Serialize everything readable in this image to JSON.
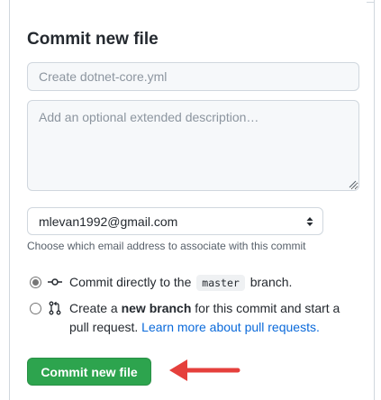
{
  "title": "Commit new file",
  "summary": {
    "placeholder": "Create dotnet-core.yml",
    "value": ""
  },
  "description": {
    "placeholder": "Add an optional extended description…",
    "value": ""
  },
  "email_select": {
    "selected": "mlevan1992@gmail.com"
  },
  "email_note": "Choose which email address to associate with this commit",
  "options": {
    "direct": {
      "prefix": "Commit directly to the",
      "branch": "master",
      "suffix": "branch.",
      "checked": true
    },
    "new_branch": {
      "prefix": "Create a",
      "bold": "new branch",
      "suffix": "for this commit and start a pull request.",
      "link": "Learn more about pull requests.",
      "checked": false
    }
  },
  "commit_button": "Commit new file",
  "colors": {
    "primary_button": "#2da44e",
    "link": "#0969da",
    "annotation_arrow": "#e5403c"
  },
  "annotation": {
    "icon": "red-arrow-icon"
  }
}
